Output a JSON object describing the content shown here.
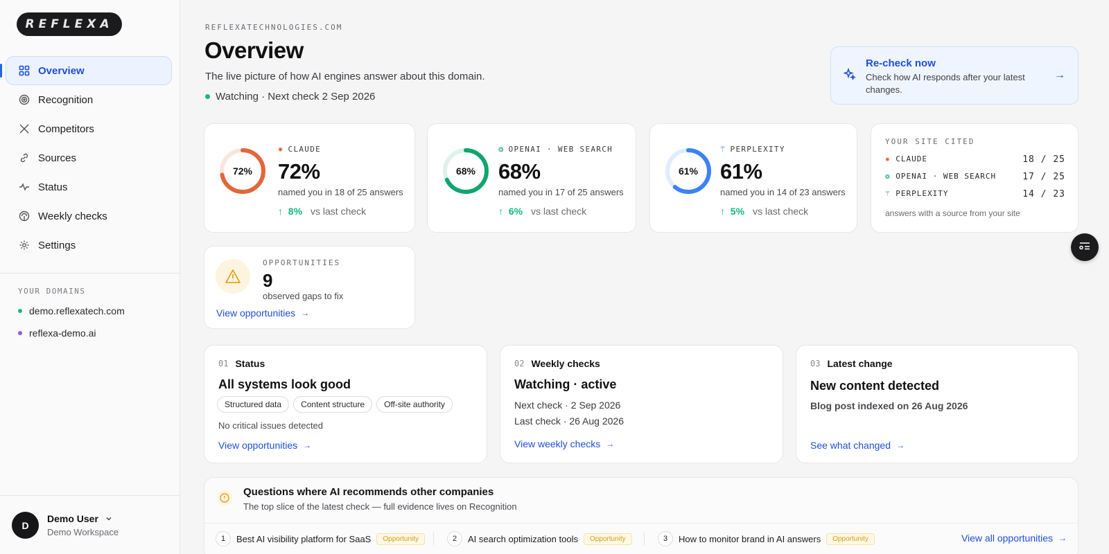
{
  "brand": {
    "logo_text": "REFLEXA"
  },
  "sidebar": {
    "items": [
      {
        "label": "Overview",
        "icon": "grid-icon",
        "active": true
      },
      {
        "label": "Recognition",
        "icon": "target-icon"
      },
      {
        "label": "Competitors",
        "icon": "swords-icon"
      },
      {
        "label": "Sources",
        "icon": "link-icon"
      },
      {
        "label": "Status",
        "icon": "pulse-icon"
      },
      {
        "label": "Weekly checks",
        "icon": "radar-icon"
      },
      {
        "label": "Settings",
        "icon": "gear-icon"
      }
    ],
    "domains_label": "YOUR DOMAINS",
    "domains": [
      {
        "name": "demo.reflexatech.com",
        "color": "#10b981"
      },
      {
        "name": "reflexa-demo.ai",
        "color": "#8b5cf6"
      }
    ],
    "user": {
      "initial": "D",
      "name": "Demo User",
      "workspace": "Demo Workspace"
    }
  },
  "header": {
    "breadcrumb": "REFLEXATECHNOLOGIES.COM",
    "title": "Overview",
    "subtitle": "The live picture of how AI engines answer about this domain.",
    "watch_status": "Watching · Next check 2 Sep 2026"
  },
  "recheck": {
    "title": "Re-check now",
    "description": "Check how AI responds after your latest changes."
  },
  "scores": [
    {
      "engine": "CLAUDE",
      "ring_label": "72%",
      "value": "72%",
      "percent": 72,
      "named": "named you in 18 of 25 answers",
      "delta": "8%",
      "delta_label": "vs last check",
      "color": "#e2673a",
      "track": "#fbe5dc"
    },
    {
      "engine": "OPENAI · WEB SEARCH",
      "ring_label": "68%",
      "value": "68%",
      "percent": 68,
      "named": "named you in 17 of 25 answers",
      "delta": "6%",
      "delta_label": "vs last check",
      "color": "#10a56e",
      "track": "#dcf3ea"
    },
    {
      "engine": "PERPLEXITY",
      "ring_label": "61%",
      "value": "61%",
      "percent": 61,
      "named": "named you in 14 of 23 answers",
      "delta": "5%",
      "delta_label": "vs last check",
      "color": "#3b82f6",
      "track": "#e1ecfd"
    }
  ],
  "cited": {
    "label": "YOUR SITE CITED",
    "rows": [
      {
        "engine": "CLAUDE",
        "value": "18 / 25"
      },
      {
        "engine": "OPENAI · WEB SEARCH",
        "value": "17 / 25"
      },
      {
        "engine": "PERPLEXITY",
        "value": "14 / 23"
      }
    ],
    "footer": "answers with a source from your site"
  },
  "opportunities": {
    "label": "OPPORTUNITIES",
    "count": "9",
    "description": "observed gaps to fix",
    "link": "View opportunities"
  },
  "summary": [
    {
      "num": "01",
      "heading": "Status",
      "title": "All systems look good",
      "chips": [
        "Structured data",
        "Content structure",
        "Off-site authority"
      ],
      "text": "No critical issues detected",
      "link": "View opportunities"
    },
    {
      "num": "02",
      "heading": "Weekly checks",
      "title": "Watching · active",
      "line1": "Next check · 2 Sep 2026",
      "line2": "Last check · 26 Aug 2026",
      "link": "View weekly checks"
    },
    {
      "num": "03",
      "heading": "Latest change",
      "title": "New content detected",
      "text": "Blog post indexed on 26 Aug 2026",
      "link": "See what changed"
    }
  ],
  "questions": {
    "title": "Questions where AI recommends other companies",
    "subtitle": "The top slice of the latest check — full evidence lives on Recognition",
    "items": [
      {
        "n": "1",
        "text": "Best AI visibility platform for SaaS",
        "badge": "Opportunity"
      },
      {
        "n": "2",
        "text": "AI search optimization tools",
        "badge": "Opportunity"
      },
      {
        "n": "3",
        "text": "How to monitor brand in AI answers",
        "badge": "Opportunity"
      }
    ],
    "link": "View all opportunities"
  }
}
